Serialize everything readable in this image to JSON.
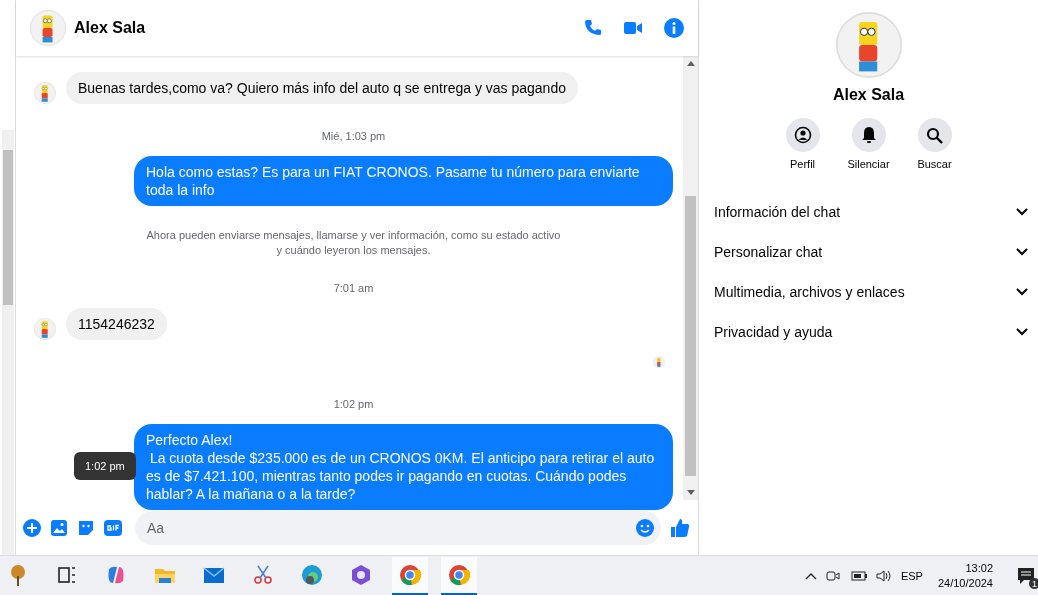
{
  "chat_header": {
    "name": "Alex Sala"
  },
  "messages": [
    {
      "kind": "incoming",
      "text": "Buenas tardes,como va? Quiero más info del auto q se entrega y vas pagando"
    },
    {
      "kind": "timestamp",
      "text": "Mié, 1:03 pm"
    },
    {
      "kind": "outgoing",
      "text": "Hola como estas? Es para un FIAT CRONOS. Pasame tu número para enviarte toda la info"
    },
    {
      "kind": "notice",
      "text": "Ahora pueden enviarse mensajes, llamarse y ver información, como su estado activo\ny cuándo leyeron los mensajes."
    },
    {
      "kind": "timestamp",
      "text": "7:01 am"
    },
    {
      "kind": "incoming",
      "text": "1154246232"
    },
    {
      "kind": "seen"
    },
    {
      "kind": "timestamp",
      "text": "1:02 pm"
    },
    {
      "kind": "outgoing",
      "text": "Perfecto Alex!\n La cuota desde $235.000 es de un CRONOS 0KM. El anticipo para retirar el auto es de $7.421.100, mientras tanto podes ir pagando en cuotas. Cuándo podes hablar? A la mañana o a la tarde?",
      "tooltip": "1:02 pm"
    }
  ],
  "composer": {
    "placeholder": "Aa"
  },
  "info_panel": {
    "name": "Alex Sala",
    "actions": [
      {
        "kind": "profile",
        "label": "Perfil"
      },
      {
        "kind": "mute",
        "label": "Silenciar"
      },
      {
        "kind": "search",
        "label": "Buscar"
      }
    ],
    "sections": [
      {
        "label": "Información del chat",
        "expanded": false
      },
      {
        "label": "Personalizar chat",
        "expanded": false
      },
      {
        "label": "Multimedia, archivos y enlaces",
        "expanded": false
      },
      {
        "label": "Privacidad y ayuda",
        "expanded": false
      }
    ]
  },
  "taskbar": {
    "apps": [
      {
        "kind": "widgets",
        "active": false
      },
      {
        "kind": "taskview",
        "active": false
      },
      {
        "kind": "copilot",
        "active": false
      },
      {
        "kind": "files",
        "active": false
      },
      {
        "kind": "mail",
        "active": false
      },
      {
        "kind": "snip",
        "active": false
      },
      {
        "kind": "edge",
        "active": false
      },
      {
        "kind": "office",
        "active": false
      },
      {
        "kind": "chrome",
        "active": true
      },
      {
        "kind": "chrome",
        "active": true
      }
    ],
    "language": "ESP",
    "time": "13:02",
    "date": "24/10/2024",
    "notification_count": "1"
  }
}
